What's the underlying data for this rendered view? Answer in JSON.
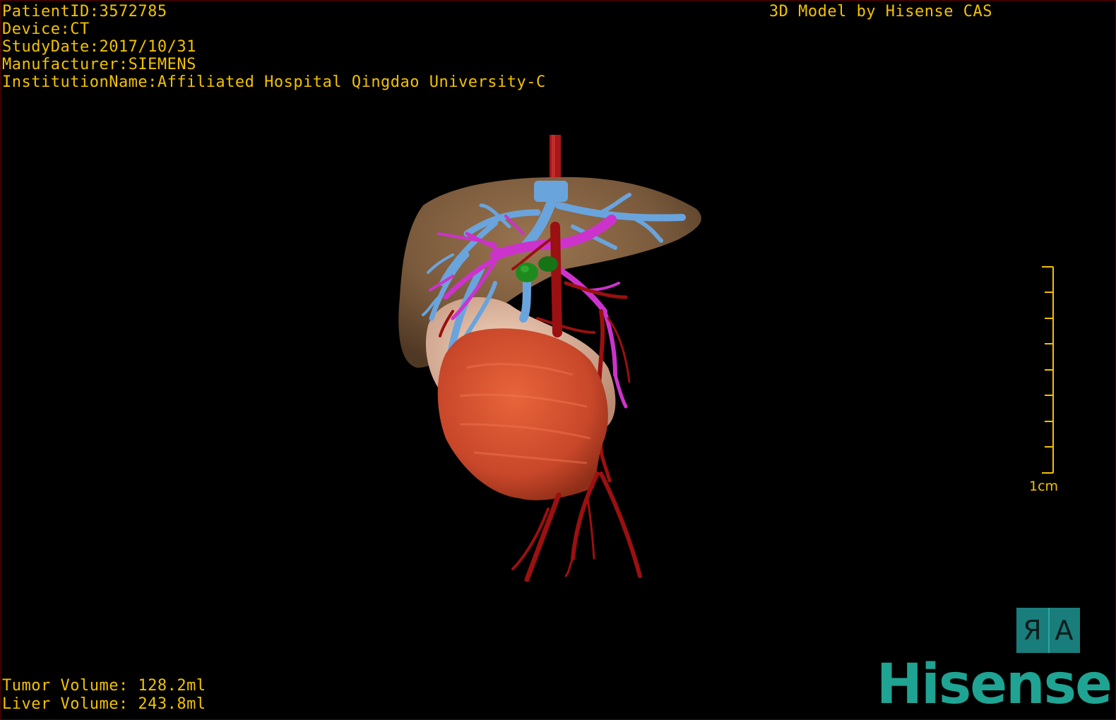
{
  "header": {
    "patient_id": "PatientID:3572785",
    "device": "Device:CT",
    "study_date": "StudyDate:2017/10/31",
    "manufacturer": "Manufacturer:SIEMENS",
    "institution": "InstitutionName:Affiliated Hospital Qingdao University-C"
  },
  "credit": "3D Model by Hisense CAS",
  "volumes": {
    "tumor": "Tumor Volume: 128.2ml",
    "liver": "Liver Volume: 243.8ml"
  },
  "scale_bar": {
    "label": "1cm"
  },
  "orientation": {
    "left_glyph": "Я",
    "right_glyph": "A"
  },
  "brand": "Hisense",
  "colors": {
    "overlay_text": "#f2c200",
    "liver": "#7a5a3c",
    "portal_vein": "#6aa4dd",
    "hepatic_vein": "#cc33cc",
    "artery": "#9b1010",
    "tumor": "#d4502e",
    "gallbladder": "#e8c0a8",
    "lesion_green": "#1e8a1e",
    "brand": "#1fa392"
  }
}
